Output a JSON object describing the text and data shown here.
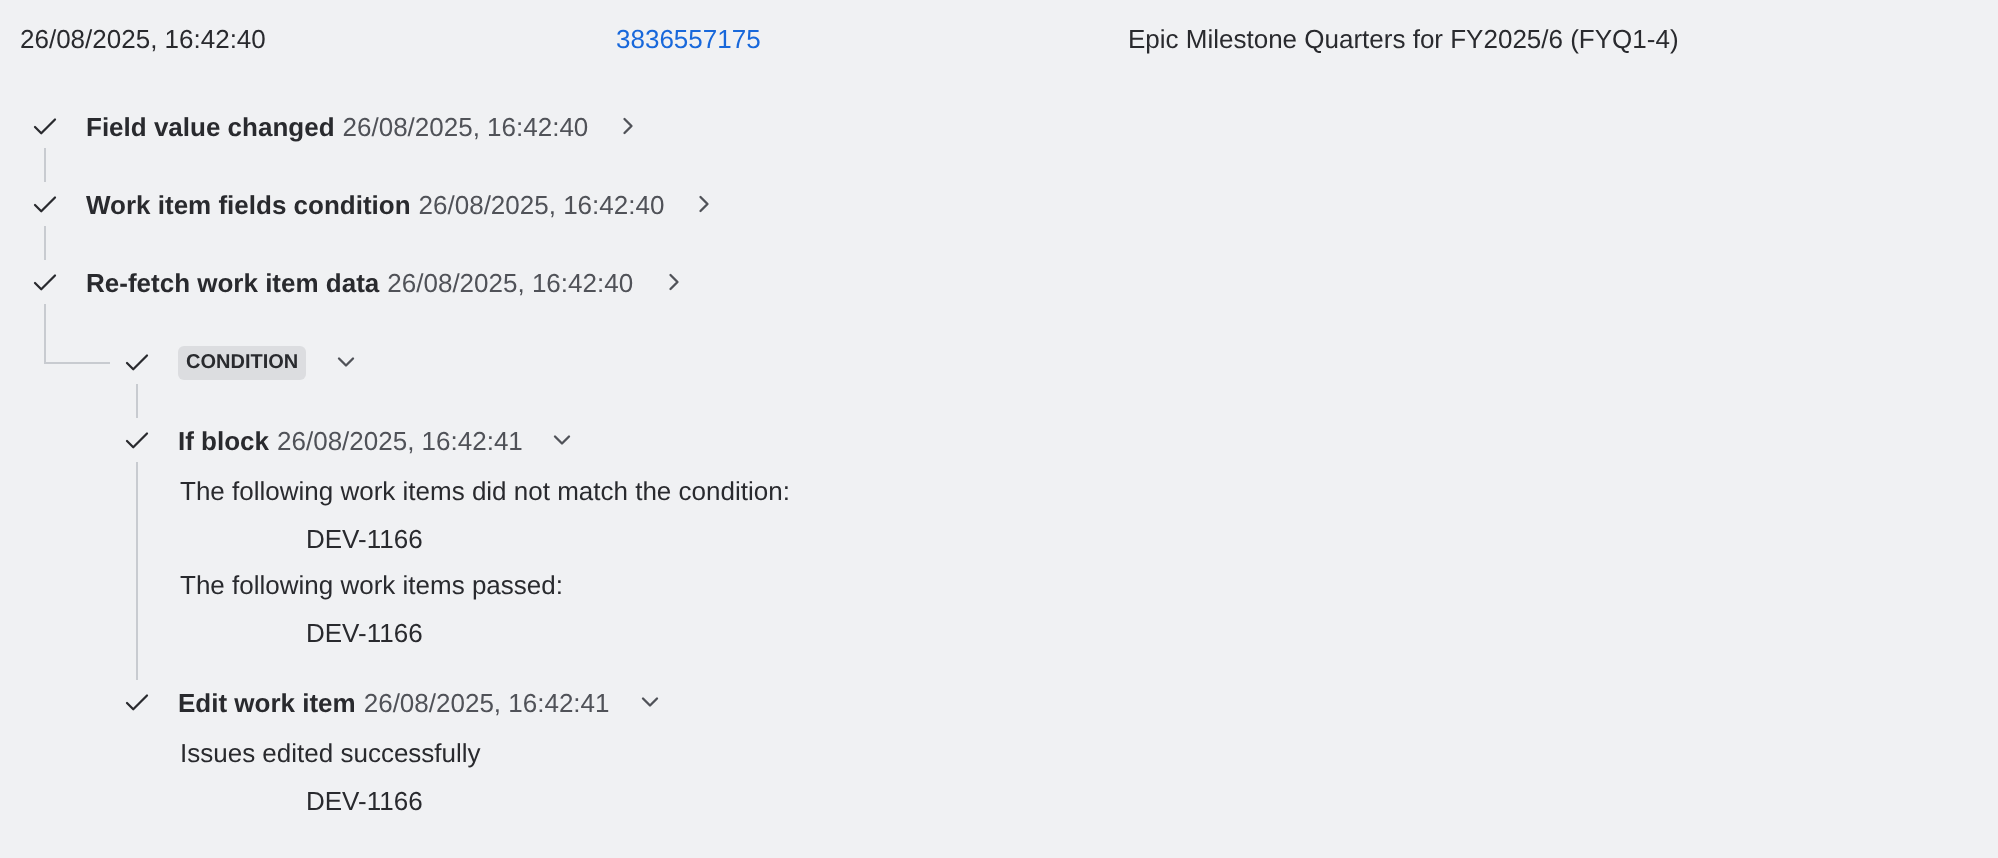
{
  "header": {
    "timestamp": "26/08/2025, 16:42:40",
    "work_item_id": "3836557175",
    "summary": "Epic Milestone Quarters for FY2025/6 (FYQ1-4)"
  },
  "steps": [
    {
      "kind": "step",
      "title": "Field value changed",
      "time": "26/08/2025, 16:42:40",
      "expanded": false
    },
    {
      "kind": "step",
      "title": "Work item fields condition",
      "time": "26/08/2025, 16:42:40",
      "expanded": false
    },
    {
      "kind": "step",
      "title": "Re-fetch work item data",
      "time": "26/08/2025, 16:42:40",
      "expanded": false,
      "children": [
        {
          "kind": "badge",
          "title": "CONDITION",
          "expanded": true,
          "children": [
            {
              "kind": "step",
              "title": "If block",
              "time": "26/08/2025, 16:42:41",
              "expanded": true,
              "details": [
                {
                  "kind": "message",
                  "text": "The following work items did not match the condition:"
                },
                {
                  "kind": "item",
                  "text": "DEV-1166"
                },
                {
                  "kind": "message",
                  "text": "The following work items passed:"
                },
                {
                  "kind": "item",
                  "text": "DEV-1166"
                }
              ]
            },
            {
              "kind": "step",
              "title": "Edit work item",
              "time": "26/08/2025, 16:42:41",
              "expanded": true,
              "details": [
                {
                  "kind": "message",
                  "text": "Issues edited successfully"
                },
                {
                  "kind": "item",
                  "text": "DEV-1166"
                }
              ]
            }
          ]
        }
      ]
    }
  ]
}
